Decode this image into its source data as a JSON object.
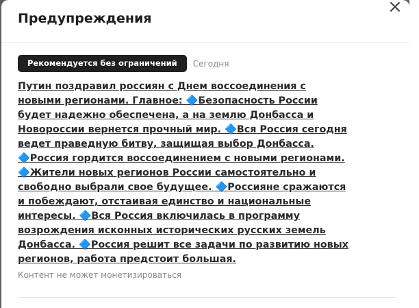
{
  "modal": {
    "title": "Предупреждения",
    "close_label": "×"
  },
  "warning": {
    "badge": "Рекомендуется без ограничений",
    "date": "Сегодня",
    "news_text": "Путин поздравил россиян с Днем воссоединения с новыми регионами. Главное: 🔷Безопасность России будет надежно обеспечена, а на землю Донбасса и Новороссии вернется прочный мир. 🔷Вся Россия сегодня ведет праведную битву, защищая выбор Донбасса. 🔷Россия гордится воссоединением с новыми регионами. 🔷Жители новых регионов России самостоятельно и свободно выбрали свое будущее. 🔷Россияне сражаются и побеждают, отстаивая единство и национальные интересы. 🔷Вся Россия включилась в программу возрождения исконных исторических русских земель Донбасса. 🔷Россия решит все задачи по развитию новых регионов, работа предстоит большая.",
    "note": "Контент не может монетизироваться"
  }
}
